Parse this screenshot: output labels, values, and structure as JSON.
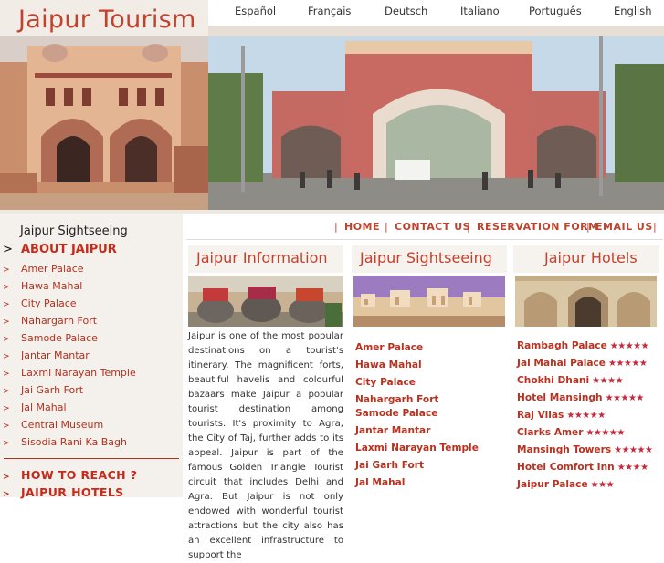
{
  "brand": {
    "title": "Jaipur Tourism"
  },
  "languages": [
    "Español",
    "Français",
    "Deutsch",
    "Italiano",
    "Português",
    "English"
  ],
  "nav": {
    "sep": "|",
    "links": [
      "HOME",
      "CONTACT US",
      "RESERVATION FORM",
      "EMAIL US"
    ]
  },
  "sidebar": {
    "heading": "Jaipur Sightseeing",
    "main_arrow": ">",
    "item_arrow": ">",
    "about": "ABOUT JAIPUR",
    "items": [
      "Amer Palace",
      "Hawa Mahal",
      "City Palace",
      "Nahargarh Fort",
      "Samode Palace",
      "Jantar Mantar",
      "Laxmi Narayan Temple",
      "Jai Garh Fort",
      "Jal Mahal",
      "Central Museum",
      "Sisodia Rani Ka Bagh"
    ],
    "reach": "HOW TO REACH ?",
    "hotels": "JAIPUR HOTELS"
  },
  "columns": {
    "info": {
      "title": "Jaipur Information",
      "text": "Jaipur is one of the most popular destinations on a tourist's itinerary. The magnificent forts, beautiful havelis and colourful bazaars make Jaipur a popular tourist destination among tourists. It's proximity to Agra, the City of Taj, further adds to its appeal. Jaipur is part of the famous Golden Triangle Tourist circuit that includes Delhi and Agra. But Jaipur is not only endowed with wonderful tourist attractions but the city also has an excellent infrastructure to support the"
    },
    "sightseeing": {
      "title": "Jaipur Sightseeing",
      "links": [
        "Amer Palace",
        "Hawa Mahal",
        "City Palace",
        "Nahargarh Fort",
        "Samode Palace",
        "Jantar Mantar",
        "Laxmi Narayan Temple",
        "Jai Garh Fort",
        "Jal Mahal"
      ]
    },
    "hotels": {
      "title": "Jaipur Hotels",
      "list": [
        {
          "name": "Rambagh Palace",
          "stars": "★★★★★"
        },
        {
          "name": "Jai Mahal Palace",
          "stars": "★★★★★"
        },
        {
          "name": "Chokhi Dhani",
          "stars": "★★★★"
        },
        {
          "name": "Hotel Mansingh",
          "stars": "★★★★★"
        },
        {
          "name": "Raj Vilas",
          "stars": "★★★★★"
        },
        {
          "name": "Clarks Amer",
          "stars": "★★★★★"
        },
        {
          "name": "Mansingh Towers",
          "stars": "★★★★★"
        },
        {
          "name": "Hotel Comfort Inn",
          "stars": "★★★★"
        },
        {
          "name": "Jaipur Palace",
          "stars": "★★★"
        }
      ]
    }
  },
  "colors": {
    "accent": "#c2422e",
    "link": "#b93220",
    "star": "#c8283a",
    "panel": "#f4f0eb"
  }
}
